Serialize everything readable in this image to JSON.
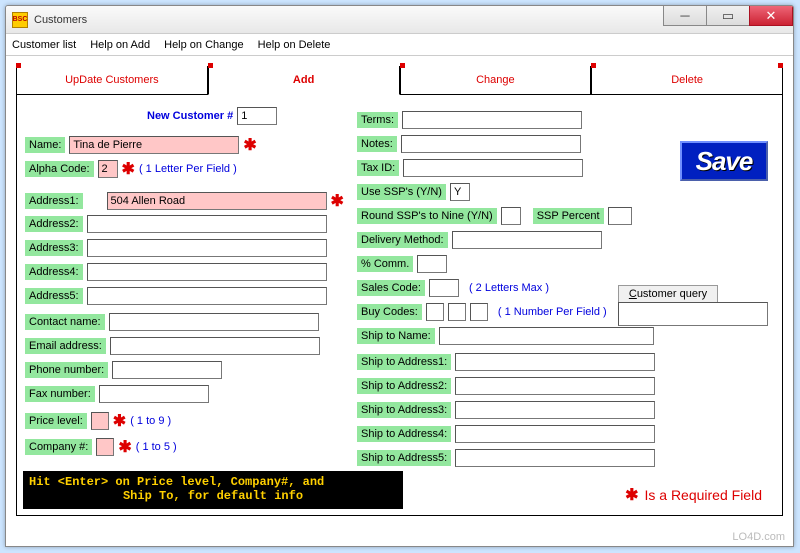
{
  "window": {
    "title": "Customers"
  },
  "menu": {
    "customer_list": "Customer list",
    "help_add": "Help on Add",
    "help_change": "Help on Change",
    "help_delete": "Help on Delete"
  },
  "tabs": {
    "update": "UpDate Customers",
    "add": "Add",
    "change": "Change",
    "delete": "Delete"
  },
  "form": {
    "new_cust_lbl": "New Customer #",
    "new_cust_val": "1",
    "name_lbl": "Name:",
    "name_val": "Tina de Pierre",
    "alpha_lbl": "Alpha Code:",
    "alpha_val": "2",
    "alpha_hint": "( 1 Letter Per Field )",
    "addr1_lbl": "Address1:",
    "addr1_val": "504 Allen Road",
    "addr2_lbl": "Address2:",
    "addr3_lbl": "Address3:",
    "addr4_lbl": "Address4:",
    "addr5_lbl": "Address5:",
    "contact_lbl": "Contact name:",
    "email_lbl": "Email address:",
    "phone_lbl": "Phone number:",
    "fax_lbl": "Fax number:",
    "price_lbl": "Price level:",
    "price_hint": "( 1 to 9 )",
    "company_lbl": "Company #:",
    "company_hint": "( 1 to 5 )",
    "terms_lbl": "Terms:",
    "notes_lbl": "Notes:",
    "tax_lbl": "Tax ID:",
    "ssp_lbl": "Use SSP's (Y/N)",
    "ssp_val": "Y",
    "round_lbl": "Round SSP's to Nine (Y/N)",
    "ssp_pct_lbl": "SSP Percent",
    "delivery_lbl": "Delivery Method:",
    "comm_lbl": "% Comm.",
    "sales_lbl": "Sales Code:",
    "sales_hint": "( 2 Letters Max )",
    "buy_lbl": "Buy Codes:",
    "buy_hint": "( 1 Number Per Field )",
    "shipname_lbl": "Ship to Name:",
    "shipa1_lbl": "Ship to Address1:",
    "shipa2_lbl": "Ship to Address2:",
    "shipa3_lbl": "Ship to Address3:",
    "shipa4_lbl": "Ship to Address4:",
    "shipa5_lbl": "Ship to Address5:"
  },
  "save_label": "Save",
  "query_label": "Customer query",
  "hint_line1": "Hit <Enter> on Price level, Company#, and",
  "hint_line2": "Ship To, for default info",
  "req_note": "Is a Required Field",
  "asterisk": "✱",
  "watermark": "LO4D.com"
}
